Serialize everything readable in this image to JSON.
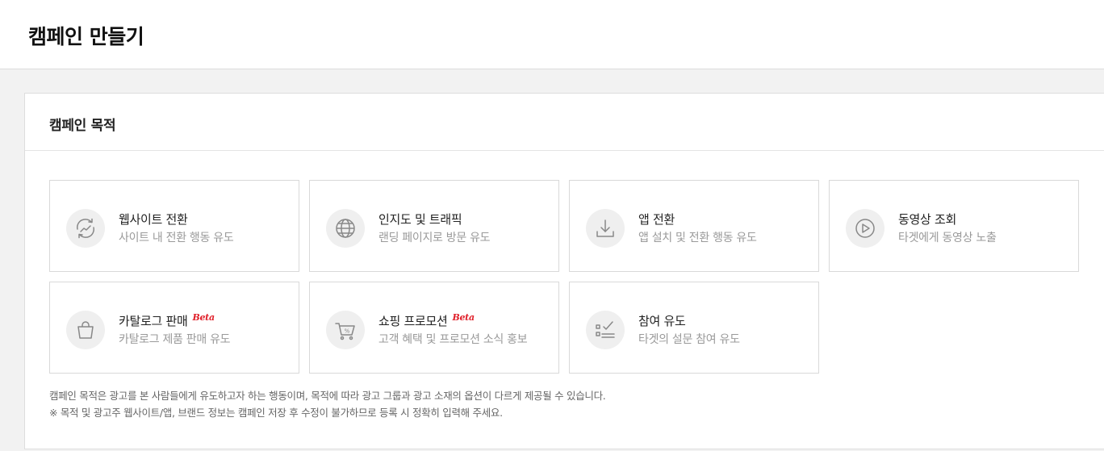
{
  "page": {
    "title": "캠페인 만들기"
  },
  "objective": {
    "title": "캠페인 목적",
    "cards": [
      {
        "title": "웹사이트 전환",
        "desc": "사이트 내 전환 행동 유도",
        "icon": "refresh-arrows-icon"
      },
      {
        "title": "인지도 및 트래픽",
        "desc": "랜딩 페이지로 방문 유도",
        "icon": "globe-icon"
      },
      {
        "title": "앱 전환",
        "desc": "앱 설치 및 전환 행동 유도",
        "icon": "download-icon"
      },
      {
        "title": "동영상 조회",
        "desc": "타겟에게 동영상 노출",
        "icon": "play-circle-icon"
      },
      {
        "title": "카탈로그 판매",
        "desc": "카탈로그 제품 판매 유도",
        "icon": "shopping-bag-icon",
        "badge": "Beta"
      },
      {
        "title": "쇼핑 프로모션",
        "desc": "고객 혜택 및 프로모션 소식 홍보",
        "icon": "discount-cart-icon",
        "badge": "Beta"
      },
      {
        "title": "참여 유도",
        "desc": "타겟의 설문 참여 유도",
        "icon": "checklist-icon"
      }
    ],
    "notes": [
      "캠페인 목적은 광고를 본 사람들에게 유도하고자 하는 행동이며, 목적에 따라 광고 그룹과 광고 소재의 옵션이 다르게 제공될 수 있습니다.",
      "※ 목적 및 광고주 웹사이트/앱, 브랜드 정보는 캠페인 저장 후 수정이 불가하므로 등록 시 정확히 입력해 주세요."
    ]
  },
  "colors": {
    "beta": "#e0202a",
    "icon": "#888888",
    "desc": "#9a9a9a"
  }
}
